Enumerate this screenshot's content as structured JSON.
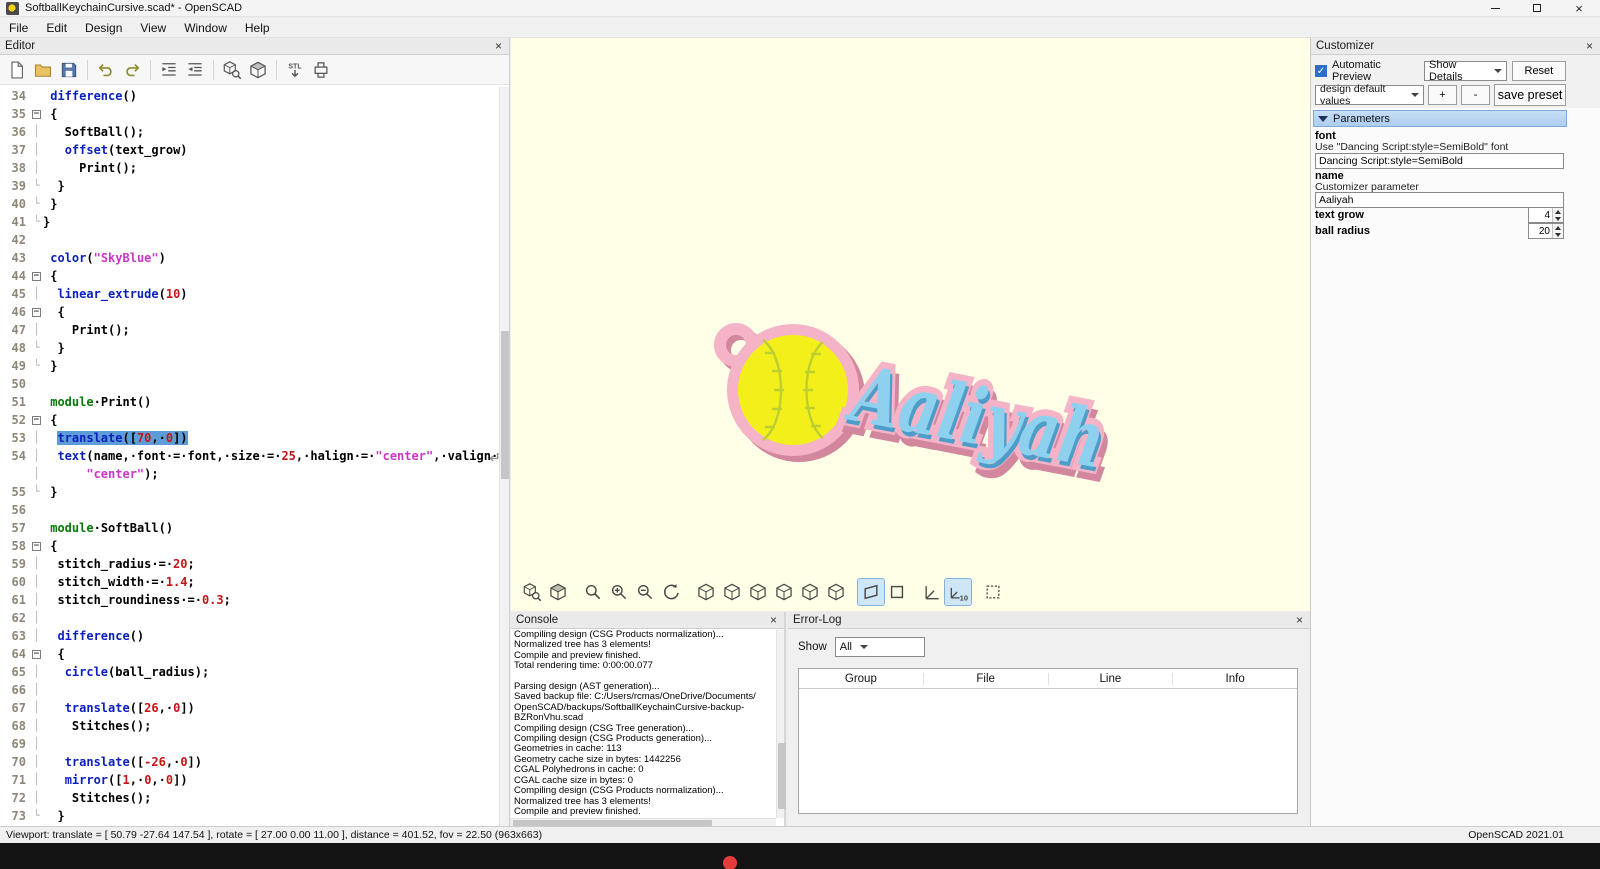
{
  "colors": {
    "keyword": "#0a1fbe",
    "module_keyword": "#067a06",
    "number": "#c41616",
    "string": "#c936c9",
    "selection_bg": "#5e9cd8",
    "viewport_bg": "#feffe6",
    "plate_pink": "#f5b3c8",
    "plate_shadow": "#d2879f",
    "ball_yellow": "#f3ef1b",
    "stitch_green": "#bccf2e",
    "text_blue": "#8dd1ef",
    "text_blue_dark": "#4e9dc8",
    "params_header_bg": "#aecdf0"
  },
  "titlebar": {
    "title": "SoftballKeychainCursive.scad* - OpenSCAD",
    "icons": [
      "app-icon",
      "minimize-icon",
      "maximize-icon",
      "close-icon"
    ]
  },
  "menubar": {
    "items": [
      "File",
      "Edit",
      "Design",
      "View",
      "Window",
      "Help"
    ]
  },
  "editor": {
    "title": "Editor",
    "toolbar_icons": [
      {
        "name": "new-file",
        "sym": "newdoc"
      },
      {
        "name": "open-file",
        "sym": "folder"
      },
      {
        "name": "save-file",
        "sym": "disk"
      },
      {
        "name": "undo",
        "sym": "undo",
        "sep": true
      },
      {
        "name": "redo",
        "sym": "redo"
      },
      {
        "name": "indent",
        "sym": "indent",
        "sep": true
      },
      {
        "name": "unindent",
        "sym": "unindent"
      },
      {
        "name": "preview",
        "sym": "preview",
        "sep": true
      },
      {
        "name": "render",
        "sym": "rendercube"
      },
      {
        "name": "export-stl",
        "sym": "stl",
        "sep": true
      },
      {
        "name": "print-3d",
        "sym": "printer"
      }
    ],
    "code": [
      {
        "n": "34",
        "f": "",
        "s": [
          [
            "p",
            " "
          ],
          [
            "k",
            "difference"
          ],
          [
            "p",
            "()"
          ]
        ]
      },
      {
        "n": "35",
        "f": "box",
        "s": [
          [
            "p",
            " {"
          ]
        ]
      },
      {
        "n": "36",
        "f": "bar",
        "s": [
          [
            "p",
            "   SoftBall();"
          ]
        ]
      },
      {
        "n": "37",
        "f": "bar",
        "s": [
          [
            "p",
            "   "
          ],
          [
            "k",
            "offset"
          ],
          [
            "p",
            "(text_grow)"
          ]
        ]
      },
      {
        "n": "38",
        "f": "bar",
        "s": [
          [
            "p",
            "     Print();"
          ]
        ]
      },
      {
        "n": "39",
        "f": "end",
        "s": [
          [
            "p",
            "  }"
          ]
        ]
      },
      {
        "n": "40",
        "f": "end",
        "s": [
          [
            "p",
            " }"
          ]
        ]
      },
      {
        "n": "41",
        "f": "end",
        "s": [
          [
            "p",
            "}"
          ]
        ]
      },
      {
        "n": "42",
        "f": "",
        "s": []
      },
      {
        "n": "43",
        "f": "",
        "s": [
          [
            "p",
            " "
          ],
          [
            "k",
            "color"
          ],
          [
            "p",
            "("
          ],
          [
            "t",
            "\"SkyBlue\""
          ],
          [
            "p",
            ")"
          ]
        ]
      },
      {
        "n": "44",
        "f": "box",
        "s": [
          [
            "p",
            " {"
          ]
        ]
      },
      {
        "n": "45",
        "f": "bar",
        "s": [
          [
            "p",
            "  "
          ],
          [
            "k",
            "linear_extrude"
          ],
          [
            "p",
            "("
          ],
          [
            "n",
            "10"
          ],
          [
            "p",
            ")"
          ]
        ]
      },
      {
        "n": "46",
        "f": "box",
        "s": [
          [
            "p",
            "  {"
          ]
        ]
      },
      {
        "n": "47",
        "f": "bar",
        "s": [
          [
            "p",
            "    Print();"
          ]
        ]
      },
      {
        "n": "48",
        "f": "end",
        "s": [
          [
            "p",
            "  }"
          ]
        ]
      },
      {
        "n": "49",
        "f": "end",
        "s": [
          [
            "p",
            " }"
          ]
        ]
      },
      {
        "n": "50",
        "f": "",
        "s": []
      },
      {
        "n": "51",
        "f": "",
        "s": [
          [
            "p",
            " "
          ],
          [
            "m",
            "module"
          ],
          [
            "p",
            "·Print()"
          ]
        ]
      },
      {
        "n": "52",
        "f": "box",
        "s": [
          [
            "p",
            " {"
          ]
        ]
      },
      {
        "n": "53",
        "f": "bar",
        "sel": true,
        "s": [
          [
            "p",
            "  "
          ],
          [
            "k",
            "translate"
          ],
          [
            "p",
            "(["
          ],
          [
            "n",
            "70"
          ],
          [
            "p",
            ",·"
          ],
          [
            "n",
            "0"
          ],
          [
            "p",
            "])"
          ]
        ]
      },
      {
        "n": "54",
        "f": "bar",
        "wrap": true,
        "s": [
          [
            "p",
            "  "
          ],
          [
            "k",
            "text"
          ],
          [
            "p",
            "(name,·font·=·font,·size·=·"
          ],
          [
            "n",
            "25"
          ],
          [
            "p",
            ",·halign·=·"
          ],
          [
            "t",
            "\"center\""
          ],
          [
            "p",
            ",·valign·=·"
          ]
        ]
      },
      {
        "n": "",
        "f": "bar",
        "s": [
          [
            "p",
            "      "
          ],
          [
            "t",
            "\"center\""
          ],
          [
            "p",
            ");"
          ]
        ]
      },
      {
        "n": "55",
        "f": "end",
        "s": [
          [
            "p",
            " }"
          ]
        ]
      },
      {
        "n": "56",
        "f": "",
        "s": []
      },
      {
        "n": "57",
        "f": "",
        "s": [
          [
            "p",
            " "
          ],
          [
            "m",
            "module"
          ],
          [
            "p",
            "·SoftBall()"
          ]
        ]
      },
      {
        "n": "58",
        "f": "box",
        "s": [
          [
            "p",
            " {"
          ]
        ]
      },
      {
        "n": "59",
        "f": "bar",
        "s": [
          [
            "p",
            "  stitch_radius·=·"
          ],
          [
            "n",
            "20"
          ],
          [
            "p",
            ";"
          ]
        ]
      },
      {
        "n": "60",
        "f": "bar",
        "s": [
          [
            "p",
            "  stitch_width·=·"
          ],
          [
            "n",
            "1.4"
          ],
          [
            "p",
            ";"
          ]
        ]
      },
      {
        "n": "61",
        "f": "bar",
        "s": [
          [
            "p",
            "  stitch_roundiness·=·"
          ],
          [
            "n",
            "0.3"
          ],
          [
            "p",
            ";"
          ]
        ]
      },
      {
        "n": "62",
        "f": "bar",
        "s": []
      },
      {
        "n": "63",
        "f": "bar",
        "s": [
          [
            "p",
            "  "
          ],
          [
            "k",
            "difference"
          ],
          [
            "p",
            "()"
          ]
        ]
      },
      {
        "n": "64",
        "f": "box",
        "s": [
          [
            "p",
            "  {"
          ]
        ]
      },
      {
        "n": "65",
        "f": "bar",
        "s": [
          [
            "p",
            "   "
          ],
          [
            "k",
            "circle"
          ],
          [
            "p",
            "(ball_radius);"
          ]
        ]
      },
      {
        "n": "66",
        "f": "bar",
        "s": []
      },
      {
        "n": "67",
        "f": "bar",
        "s": [
          [
            "p",
            "   "
          ],
          [
            "k",
            "translate"
          ],
          [
            "p",
            "(["
          ],
          [
            "n",
            "26"
          ],
          [
            "p",
            ",·"
          ],
          [
            "n",
            "0"
          ],
          [
            "p",
            "])"
          ]
        ]
      },
      {
        "n": "68",
        "f": "bar",
        "s": [
          [
            "p",
            "    Stitches();"
          ]
        ]
      },
      {
        "n": "69",
        "f": "bar",
        "s": []
      },
      {
        "n": "70",
        "f": "bar",
        "s": [
          [
            "p",
            "   "
          ],
          [
            "k",
            "translate"
          ],
          [
            "p",
            "(["
          ],
          [
            "n",
            "-26"
          ],
          [
            "p",
            ",·"
          ],
          [
            "n",
            "0"
          ],
          [
            "p",
            "])"
          ]
        ]
      },
      {
        "n": "71",
        "f": "bar",
        "s": [
          [
            "p",
            "   "
          ],
          [
            "k",
            "mirror"
          ],
          [
            "p",
            "(["
          ],
          [
            "n",
            "1"
          ],
          [
            "p",
            ",·"
          ],
          [
            "n",
            "0"
          ],
          [
            "p",
            ",·"
          ],
          [
            "n",
            "0"
          ],
          [
            "p",
            "])"
          ]
        ]
      },
      {
        "n": "72",
        "f": "bar",
        "s": [
          [
            "p",
            "    Stitches();"
          ]
        ]
      },
      {
        "n": "73",
        "f": "end",
        "s": [
          [
            "p",
            "  }"
          ]
        ]
      }
    ]
  },
  "viewport": {
    "model": {
      "text": "Aaliyah"
    },
    "toolbar_icons": [
      {
        "name": "preview",
        "sym": "preview"
      },
      {
        "name": "render",
        "sym": "rendercube"
      },
      {
        "name": "view-all",
        "sym": "mag",
        "sep": true
      },
      {
        "name": "zoom-in",
        "sym": "magplus"
      },
      {
        "name": "zoom-out",
        "sym": "magminus"
      },
      {
        "name": "reset-view",
        "sym": "reset"
      },
      {
        "name": "view-right",
        "sym": "cube",
        "sep": true
      },
      {
        "name": "view-top",
        "sym": "cube"
      },
      {
        "name": "view-bottom",
        "sym": "cube"
      },
      {
        "name": "view-left",
        "sym": "cube"
      },
      {
        "name": "view-front",
        "sym": "cube"
      },
      {
        "name": "view-back",
        "sym": "cube"
      },
      {
        "name": "perspective",
        "sym": "persp",
        "sep": true,
        "active": true
      },
      {
        "name": "orthogonal",
        "sym": "ortho"
      },
      {
        "name": "show-axes",
        "sym": "axes",
        "sep": true
      },
      {
        "name": "show-scale-markers",
        "sym": "axes10",
        "active": true
      },
      {
        "name": "view-crosshairs",
        "sym": "cross",
        "sep": true
      }
    ]
  },
  "console": {
    "title": "Console",
    "lines": [
      "Compiling design (CSG Products normalization)...",
      "Normalized tree has 3 elements!",
      "Compile and preview finished.",
      "Total rendering time: 0:00:00.077",
      "",
      "Parsing design (AST generation)...",
      "Saved backup file: C:/Users/rcmas/OneDrive/Documents/",
      "OpenSCAD/backups/SoftballKeychainCursive-backup-",
      "BZRonVhu.scad",
      "Compiling design (CSG Tree generation)...",
      "Compiling design (CSG Products generation)...",
      "Geometries in cache: 113",
      "Geometry cache size in bytes: 1442256",
      "CGAL Polyhedrons in cache: 0",
      "CGAL cache size in bytes: 0",
      "Compiling design (CSG Products normalization)...",
      "Normalized tree has 3 elements!",
      "Compile and preview finished."
    ]
  },
  "errorlog": {
    "title": "Error-Log",
    "show_label": "Show",
    "filter_value": "All",
    "columns": [
      "Group",
      "File",
      "Line",
      "Info"
    ]
  },
  "customizer": {
    "title": "Customizer",
    "auto_preview_label": "Automatic Preview",
    "details_dropdown": "Show Details",
    "reset_button": "Reset",
    "preset_dropdown": "design default values",
    "plus_button": "+",
    "minus_button": "-",
    "save_preset_button": "save preset",
    "parameters_header": "Parameters",
    "params": {
      "font": {
        "label": "font",
        "desc": "Use \"Dancing Script:style=SemiBold\" font",
        "value": "Dancing Script:style=SemiBold"
      },
      "name": {
        "label": "name",
        "desc": "Customizer parameter",
        "value": "Aaliyah"
      },
      "text_grow": {
        "label": "text grow",
        "value": "4"
      },
      "ball_radius": {
        "label": "ball radius",
        "value": "20"
      }
    }
  },
  "statusbar": {
    "left": "Viewport: translate = [ 50.79 -27.64 147.54 ], rotate = [ 27.00 0.00 11.00 ], distance = 401.52, fov = 22.50 (963x663)",
    "right": "OpenSCAD 2021.01"
  }
}
